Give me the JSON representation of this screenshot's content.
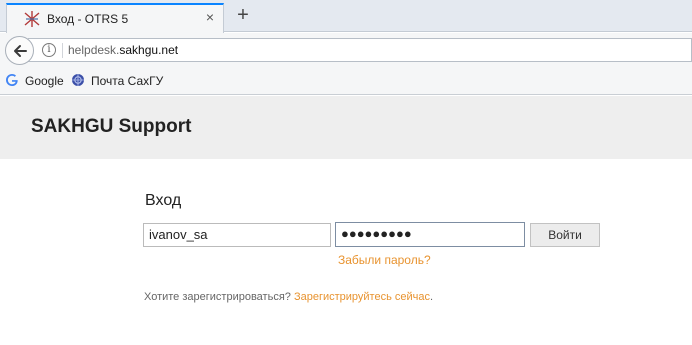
{
  "browser": {
    "tab_title": "Вход - OTRS 5",
    "tab_close": "×",
    "new_tab": "+",
    "url_prefix": "helpdesk.",
    "url_domain": "sakhgu.net",
    "bookmarks": [
      {
        "label": "Google",
        "icon": "google-icon"
      },
      {
        "label": "Почта СахГУ",
        "icon": "mail-globe-icon"
      }
    ]
  },
  "page": {
    "site_title": "SAKHGU Support",
    "login_title": "Вход",
    "username_value": "ivanov_sa",
    "password_mask": "●●●●●●●●●",
    "login_button": "Войти",
    "forgot_link": "Забыли пароль?",
    "register_text": "Хотите зарегистрироваться?",
    "register_link": "Зарегистрируйтесь сейчас",
    "register_end": "."
  },
  "colors": {
    "accent_link": "#e8932f",
    "header_bg": "#eeeeee",
    "tab_highlight": "#0a84ff"
  }
}
